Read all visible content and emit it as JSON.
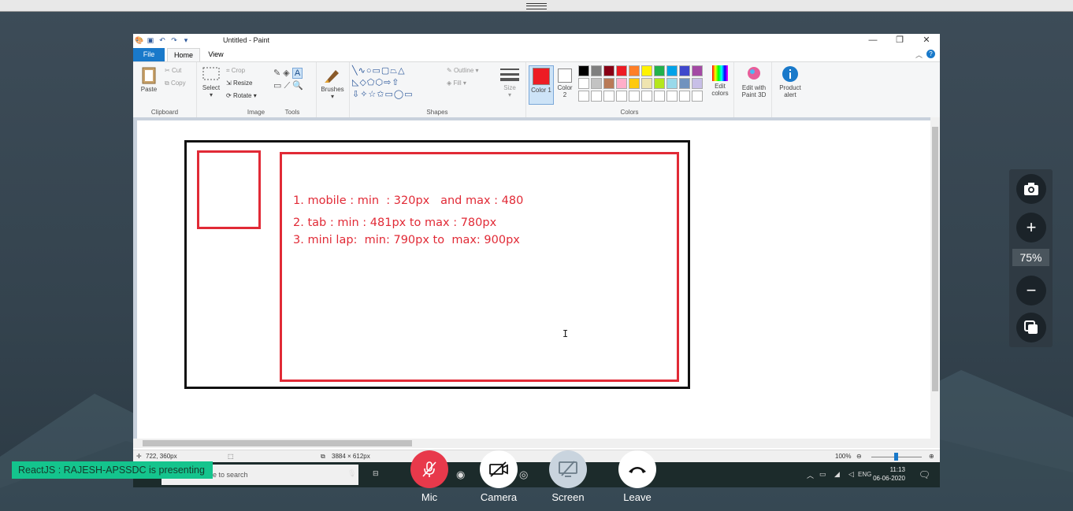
{
  "paint": {
    "title": "Untitled - Paint",
    "menu": {
      "file": "File",
      "home": "Home",
      "view": "View"
    },
    "clipboard": {
      "paste": "Paste",
      "cut": "Cut",
      "copy": "Copy",
      "label": "Clipboard"
    },
    "image": {
      "select": "Select",
      "crop": "Crop",
      "resize": "Resize",
      "rotate": "Rotate",
      "label": "Image"
    },
    "tools": {
      "label": "Tools"
    },
    "brushes": {
      "label": "Brushes"
    },
    "shapes": {
      "outline": "Outline",
      "fill": "Fill",
      "label": "Shapes"
    },
    "size": {
      "label": "Size"
    },
    "colors": {
      "color1": "Color 1",
      "color2": "Color 2",
      "edit": "Edit colors",
      "label": "Colors",
      "color1_value": "#ed1c24",
      "color2_value": "#ffffff",
      "palette_row1": [
        "#000000",
        "#7f7f7f",
        "#880015",
        "#ed1c24",
        "#ff7f27",
        "#fff200",
        "#22b14c",
        "#00a2e8",
        "#3f48cc",
        "#a349a4"
      ],
      "palette_row2": [
        "#ffffff",
        "#c3c3c3",
        "#b97a57",
        "#ffaec9",
        "#ffc90e",
        "#efe4b0",
        "#b5e61d",
        "#99d9ea",
        "#7092be",
        "#c8bfe7"
      ],
      "palette_row3": [
        "#ffffff",
        "#ffffff",
        "#ffffff",
        "#ffffff",
        "#ffffff",
        "#ffffff",
        "#ffffff",
        "#ffffff",
        "#ffffff",
        "#ffffff"
      ]
    },
    "paint3d": "Edit with Paint 3D",
    "product_alert": "Product alert",
    "canvas": {
      "lines": [
        "1. mobile : min  : 320px   and max : 480",
        "2. tab : min : 481px to max : 780px",
        "3. mini lap:  min: 790px to  max: 900px"
      ]
    },
    "status": {
      "cursor_pos": "722, 360px",
      "canvas_size": "3884 × 612px",
      "zoom": "100%"
    }
  },
  "taskbar": {
    "search_placeholder": "Type here to search",
    "lang": "ENG",
    "time": "11:13",
    "date": "06-06-2020"
  },
  "viewer": {
    "zoom_level": "75%"
  },
  "presenter_text": "ReactJS : RAJESH-APSSDC is presenting",
  "controls": {
    "mic": "Mic",
    "camera": "Camera",
    "screen": "Screen",
    "leave": "Leave"
  }
}
